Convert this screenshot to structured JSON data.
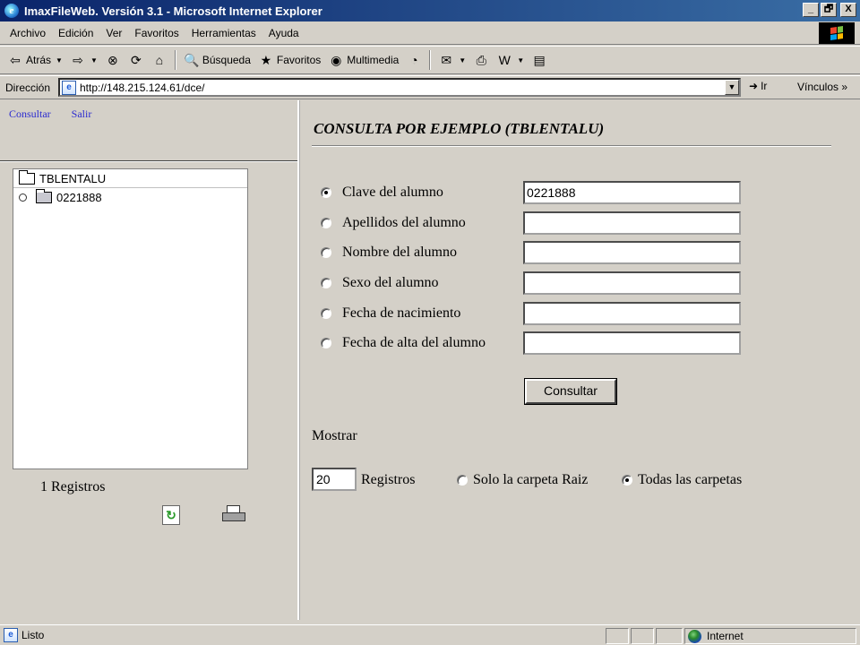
{
  "window": {
    "title": "ImaxFileWeb. Versión 3.1 - Microsoft Internet Explorer",
    "buttons": [
      "_",
      "🗗",
      "X"
    ]
  },
  "menu": [
    "Archivo",
    "Edición",
    "Ver",
    "Favoritos",
    "Herramientas",
    "Ayuda"
  ],
  "toolbar": {
    "back": "Atrás",
    "search": "Búsqueda",
    "favorites": "Favoritos",
    "multimedia": "Multimedia"
  },
  "address": {
    "label": "Dirección",
    "url": "http://148.215.124.61/dce/",
    "go": "Ir",
    "links": "Vínculos"
  },
  "left": {
    "nav": [
      "Consultar",
      "Salir"
    ],
    "tree": {
      "root": "TBLENTALU",
      "children": [
        "0221888"
      ]
    },
    "count": "1 Registros"
  },
  "form": {
    "title": "CONSULTA POR EJEMPLO (TBLENTALU)",
    "fields": [
      {
        "label": "Clave del alumno",
        "value": "0221888",
        "checked": true
      },
      {
        "label": "Apellidos del alumno",
        "value": "",
        "checked": false
      },
      {
        "label": "Nombre del alumno",
        "value": "",
        "checked": false
      },
      {
        "label": "Sexo del alumno",
        "value": "",
        "checked": false
      },
      {
        "label": "Fecha de nacimiento",
        "value": "",
        "checked": false
      },
      {
        "label": "Fecha de alta del alumno",
        "value": "",
        "checked": false
      }
    ],
    "submit": "Consultar",
    "show_label": "Mostrar",
    "limit": "20",
    "limit_unit": "Registros",
    "scope_options": [
      {
        "label": "Solo la carpeta Raiz",
        "checked": false
      },
      {
        "label": "Todas las carpetas",
        "checked": true
      }
    ]
  },
  "status": {
    "text": "Listo",
    "zone": "Internet"
  },
  "colors": {
    "title_bar_start": "#0a246a",
    "title_bar_end": "#3a6ea5",
    "link": "#2a2ad0",
    "chrome": "#d4d0c8"
  }
}
